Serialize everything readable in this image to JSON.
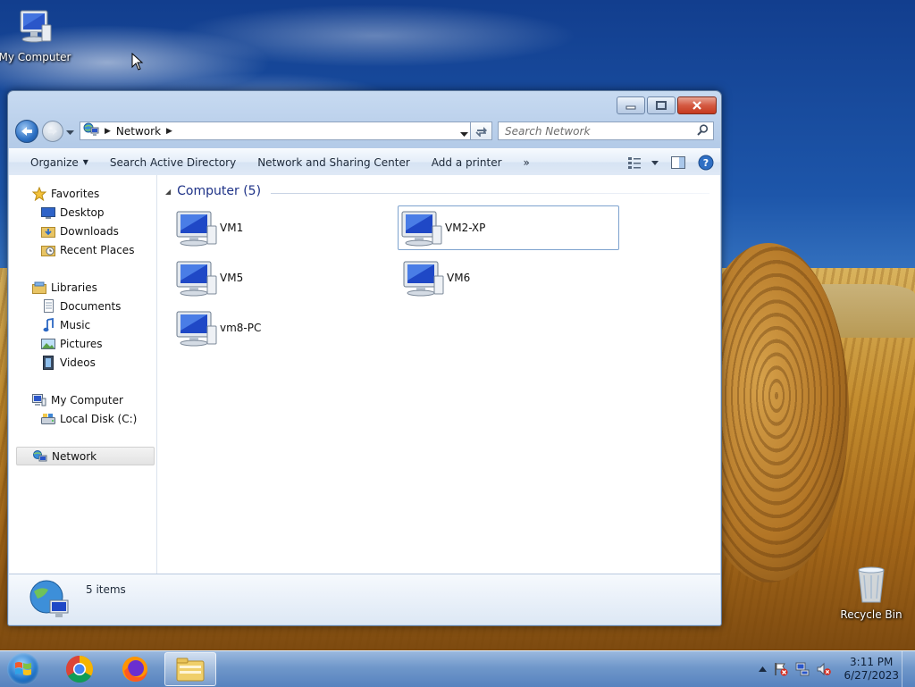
{
  "desktop": {
    "icons": [
      {
        "label": "My Computer"
      },
      {
        "label": "Recycle Bin"
      }
    ]
  },
  "window": {
    "address": {
      "crumbs": [
        "Network"
      ]
    },
    "search": {
      "placeholder": "Search Network"
    },
    "commands": {
      "organize": "Organize",
      "search_ad": "Search Active Directory",
      "sharing_center": "Network and Sharing Center",
      "add_printer": "Add a printer",
      "more": "»"
    },
    "nav": {
      "favorites": "Favorites",
      "desktop": "Desktop",
      "downloads": "Downloads",
      "recent": "Recent Places",
      "libraries": "Libraries",
      "documents": "Documents",
      "music": "Music",
      "pictures": "Pictures",
      "videos": "Videos",
      "my_computer": "My Computer",
      "local_disk": "Local Disk (C:)",
      "network": "Network"
    },
    "group": {
      "title": "Computer (5)"
    },
    "computers": [
      "VM1",
      "VM2-XP",
      "VM5",
      "VM6",
      "vm8-PC"
    ],
    "details": {
      "count": "5 items"
    }
  },
  "taskbar": {
    "clock": {
      "time": "3:11 PM",
      "date": "6/27/2023"
    }
  },
  "colors": {
    "accent": "#1e3287",
    "selection_border": "#7da2ce",
    "window_frame": "#b4cbe8"
  }
}
